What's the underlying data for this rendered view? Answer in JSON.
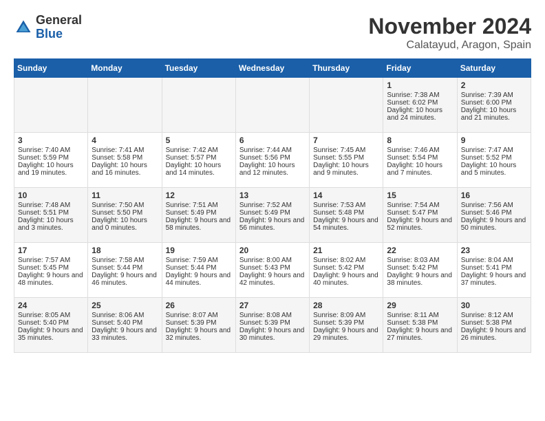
{
  "header": {
    "logo_line1": "General",
    "logo_line2": "Blue",
    "month_title": "November 2024",
    "location": "Calatayud, Aragon, Spain"
  },
  "days_of_week": [
    "Sunday",
    "Monday",
    "Tuesday",
    "Wednesday",
    "Thursday",
    "Friday",
    "Saturday"
  ],
  "weeks": [
    [
      {
        "day": "",
        "sunrise": "",
        "sunset": "",
        "daylight": ""
      },
      {
        "day": "",
        "sunrise": "",
        "sunset": "",
        "daylight": ""
      },
      {
        "day": "",
        "sunrise": "",
        "sunset": "",
        "daylight": ""
      },
      {
        "day": "",
        "sunrise": "",
        "sunset": "",
        "daylight": ""
      },
      {
        "day": "",
        "sunrise": "",
        "sunset": "",
        "daylight": ""
      },
      {
        "day": "1",
        "sunrise": "Sunrise: 7:38 AM",
        "sunset": "Sunset: 6:02 PM",
        "daylight": "Daylight: 10 hours and 24 minutes."
      },
      {
        "day": "2",
        "sunrise": "Sunrise: 7:39 AM",
        "sunset": "Sunset: 6:00 PM",
        "daylight": "Daylight: 10 hours and 21 minutes."
      }
    ],
    [
      {
        "day": "3",
        "sunrise": "Sunrise: 7:40 AM",
        "sunset": "Sunset: 5:59 PM",
        "daylight": "Daylight: 10 hours and 19 minutes."
      },
      {
        "day": "4",
        "sunrise": "Sunrise: 7:41 AM",
        "sunset": "Sunset: 5:58 PM",
        "daylight": "Daylight: 10 hours and 16 minutes."
      },
      {
        "day": "5",
        "sunrise": "Sunrise: 7:42 AM",
        "sunset": "Sunset: 5:57 PM",
        "daylight": "Daylight: 10 hours and 14 minutes."
      },
      {
        "day": "6",
        "sunrise": "Sunrise: 7:44 AM",
        "sunset": "Sunset: 5:56 PM",
        "daylight": "Daylight: 10 hours and 12 minutes."
      },
      {
        "day": "7",
        "sunrise": "Sunrise: 7:45 AM",
        "sunset": "Sunset: 5:55 PM",
        "daylight": "Daylight: 10 hours and 9 minutes."
      },
      {
        "day": "8",
        "sunrise": "Sunrise: 7:46 AM",
        "sunset": "Sunset: 5:54 PM",
        "daylight": "Daylight: 10 hours and 7 minutes."
      },
      {
        "day": "9",
        "sunrise": "Sunrise: 7:47 AM",
        "sunset": "Sunset: 5:52 PM",
        "daylight": "Daylight: 10 hours and 5 minutes."
      }
    ],
    [
      {
        "day": "10",
        "sunrise": "Sunrise: 7:48 AM",
        "sunset": "Sunset: 5:51 PM",
        "daylight": "Daylight: 10 hours and 3 minutes."
      },
      {
        "day": "11",
        "sunrise": "Sunrise: 7:50 AM",
        "sunset": "Sunset: 5:50 PM",
        "daylight": "Daylight: 10 hours and 0 minutes."
      },
      {
        "day": "12",
        "sunrise": "Sunrise: 7:51 AM",
        "sunset": "Sunset: 5:49 PM",
        "daylight": "Daylight: 9 hours and 58 minutes."
      },
      {
        "day": "13",
        "sunrise": "Sunrise: 7:52 AM",
        "sunset": "Sunset: 5:49 PM",
        "daylight": "Daylight: 9 hours and 56 minutes."
      },
      {
        "day": "14",
        "sunrise": "Sunrise: 7:53 AM",
        "sunset": "Sunset: 5:48 PM",
        "daylight": "Daylight: 9 hours and 54 minutes."
      },
      {
        "day": "15",
        "sunrise": "Sunrise: 7:54 AM",
        "sunset": "Sunset: 5:47 PM",
        "daylight": "Daylight: 9 hours and 52 minutes."
      },
      {
        "day": "16",
        "sunrise": "Sunrise: 7:56 AM",
        "sunset": "Sunset: 5:46 PM",
        "daylight": "Daylight: 9 hours and 50 minutes."
      }
    ],
    [
      {
        "day": "17",
        "sunrise": "Sunrise: 7:57 AM",
        "sunset": "Sunset: 5:45 PM",
        "daylight": "Daylight: 9 hours and 48 minutes."
      },
      {
        "day": "18",
        "sunrise": "Sunrise: 7:58 AM",
        "sunset": "Sunset: 5:44 PM",
        "daylight": "Daylight: 9 hours and 46 minutes."
      },
      {
        "day": "19",
        "sunrise": "Sunrise: 7:59 AM",
        "sunset": "Sunset: 5:44 PM",
        "daylight": "Daylight: 9 hours and 44 minutes."
      },
      {
        "day": "20",
        "sunrise": "Sunrise: 8:00 AM",
        "sunset": "Sunset: 5:43 PM",
        "daylight": "Daylight: 9 hours and 42 minutes."
      },
      {
        "day": "21",
        "sunrise": "Sunrise: 8:02 AM",
        "sunset": "Sunset: 5:42 PM",
        "daylight": "Daylight: 9 hours and 40 minutes."
      },
      {
        "day": "22",
        "sunrise": "Sunrise: 8:03 AM",
        "sunset": "Sunset: 5:42 PM",
        "daylight": "Daylight: 9 hours and 38 minutes."
      },
      {
        "day": "23",
        "sunrise": "Sunrise: 8:04 AM",
        "sunset": "Sunset: 5:41 PM",
        "daylight": "Daylight: 9 hours and 37 minutes."
      }
    ],
    [
      {
        "day": "24",
        "sunrise": "Sunrise: 8:05 AM",
        "sunset": "Sunset: 5:40 PM",
        "daylight": "Daylight: 9 hours and 35 minutes."
      },
      {
        "day": "25",
        "sunrise": "Sunrise: 8:06 AM",
        "sunset": "Sunset: 5:40 PM",
        "daylight": "Daylight: 9 hours and 33 minutes."
      },
      {
        "day": "26",
        "sunrise": "Sunrise: 8:07 AM",
        "sunset": "Sunset: 5:39 PM",
        "daylight": "Daylight: 9 hours and 32 minutes."
      },
      {
        "day": "27",
        "sunrise": "Sunrise: 8:08 AM",
        "sunset": "Sunset: 5:39 PM",
        "daylight": "Daylight: 9 hours and 30 minutes."
      },
      {
        "day": "28",
        "sunrise": "Sunrise: 8:09 AM",
        "sunset": "Sunset: 5:39 PM",
        "daylight": "Daylight: 9 hours and 29 minutes."
      },
      {
        "day": "29",
        "sunrise": "Sunrise: 8:11 AM",
        "sunset": "Sunset: 5:38 PM",
        "daylight": "Daylight: 9 hours and 27 minutes."
      },
      {
        "day": "30",
        "sunrise": "Sunrise: 8:12 AM",
        "sunset": "Sunset: 5:38 PM",
        "daylight": "Daylight: 9 hours and 26 minutes."
      }
    ]
  ]
}
